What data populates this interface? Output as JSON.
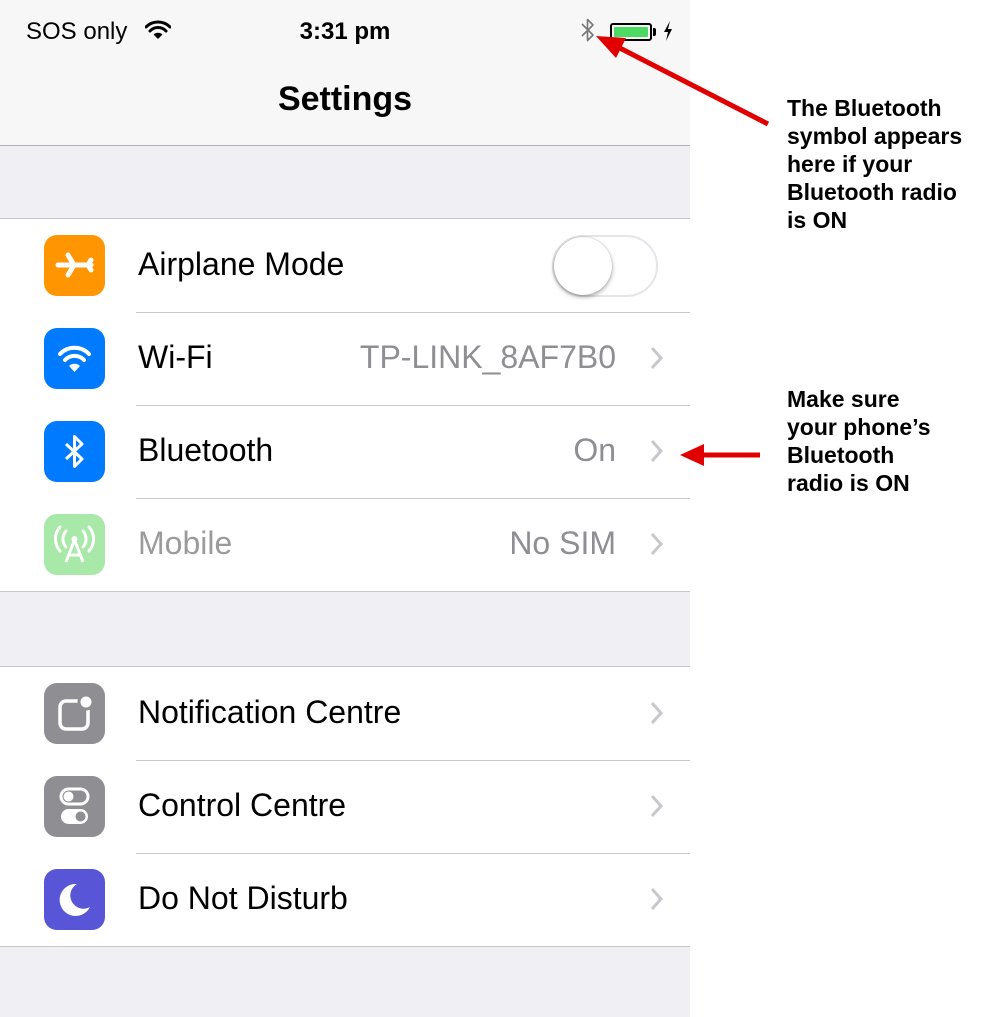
{
  "status_bar": {
    "carrier": "SOS only",
    "time": "3:31 pm",
    "wifi_icon": "wifi-icon",
    "bluetooth_icon": "bluetooth-icon",
    "battery_level": 1.0,
    "charging_icon": "bolt-icon"
  },
  "nav": {
    "title": "Settings"
  },
  "groups": [
    {
      "rows": [
        {
          "label": "Airplane Mode",
          "icon": "airplane-icon",
          "icon_color": "#ff9500",
          "control": "toggle",
          "toggle_on": false
        },
        {
          "label": "Wi-Fi",
          "icon": "wifi-icon",
          "icon_color": "#007aff",
          "value": "TP-LINK_8AF7B0"
        },
        {
          "label": "Bluetooth",
          "icon": "bluetooth-icon",
          "icon_color": "#007aff",
          "value": "On"
        },
        {
          "label": "Mobile",
          "icon": "antenna-icon",
          "icon_color": "#a8e8a8",
          "value": "No SIM",
          "disabled": true
        }
      ]
    },
    {
      "rows": [
        {
          "label": "Notification Centre",
          "icon": "notification-icon",
          "icon_color": "#8e8e93"
        },
        {
          "label": "Control Centre",
          "icon": "switches-icon",
          "icon_color": "#8e8e93"
        },
        {
          "label": "Do Not Disturb",
          "icon": "moon-icon",
          "icon_color": "#5856d6"
        }
      ]
    }
  ],
  "annotations": [
    {
      "text": "The Bluetooth\nsymbol appears\nhere if your\nBluetooth radio\nis ON"
    },
    {
      "text": "Make sure\nyour phone’s\nBluetooth\nradio is ON"
    }
  ],
  "colors": {
    "arrow": "#e00000",
    "accent": "#007aff"
  }
}
